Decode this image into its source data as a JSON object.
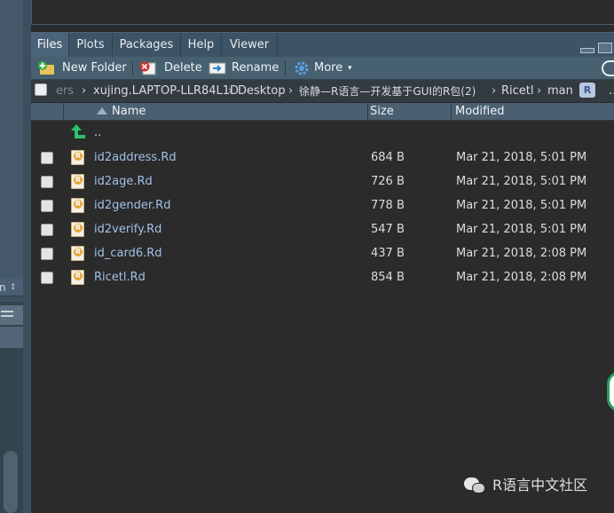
{
  "left_pane": {
    "select_text": "n",
    "select_arrows": "↕"
  },
  "tabs": [
    {
      "label": "Files",
      "active": true
    },
    {
      "label": "Plots",
      "active": false
    },
    {
      "label": "Packages",
      "active": false
    },
    {
      "label": "Help",
      "active": false
    },
    {
      "label": "Viewer",
      "active": false
    }
  ],
  "toolbar": {
    "new_folder": "New Folder",
    "delete": "Delete",
    "rename": "Rename",
    "more": "More",
    "more_caret": "▾"
  },
  "breadcrumb": {
    "items": [
      "ers",
      "xujing.LAPTOP-LLR84L1D",
      "Desktop",
      "徐静—R语言—开发基于GUI的R包(2)",
      "Ricetl",
      "man"
    ],
    "separator": "›",
    "badge": "R",
    "overflow": "..."
  },
  "columns": {
    "name": "Name",
    "size": "Size",
    "modified": "Modified"
  },
  "parent_dir": "..",
  "files": [
    {
      "name": "id2address.Rd",
      "size": "684 B",
      "modified": "Mar 21, 2018, 5:01 PM"
    },
    {
      "name": "id2age.Rd",
      "size": "726 B",
      "modified": "Mar 21, 2018, 5:01 PM"
    },
    {
      "name": "id2gender.Rd",
      "size": "778 B",
      "modified": "Mar 21, 2018, 5:01 PM"
    },
    {
      "name": "id2verify.Rd",
      "size": "547 B",
      "modified": "Mar 21, 2018, 5:01 PM"
    },
    {
      "name": "id_card6.Rd",
      "size": "437 B",
      "modified": "Mar 21, 2018, 2:08 PM"
    },
    {
      "name": "Ricetl.Rd",
      "size": "854 B",
      "modified": "Mar 21, 2018, 2:08 PM"
    }
  ],
  "watermark": "R语言中文社区",
  "colors": {
    "accent": "#4a6378",
    "link": "#9fc0e8",
    "up_arrow": "#2bc46a"
  }
}
